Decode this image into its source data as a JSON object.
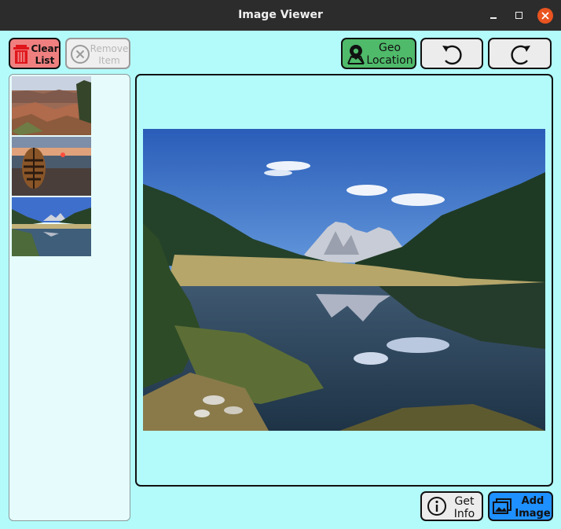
{
  "window": {
    "title": "Image Viewer"
  },
  "toolbar": {
    "clear_list": "Clear List",
    "remove_item": "Remove Item",
    "geo_location": "Geo Location"
  },
  "thumbnails": [
    {
      "name": "canyon"
    },
    {
      "name": "tiger-egg-sunset"
    },
    {
      "name": "mountain-lake"
    }
  ],
  "footer": {
    "get_info": "Get Info",
    "add_image": "Add Image"
  },
  "icons": {
    "clear": "trash-icon",
    "remove": "x-circle-icon",
    "geo": "map-pin-icon",
    "rotate_left": "rotate-ccw-icon",
    "rotate_right": "rotate-cw-icon",
    "info": "info-icon",
    "add": "images-icon"
  },
  "colors": {
    "background": "#b3fbfb",
    "clear_button": "#f08080",
    "geo_button": "#4fba6a",
    "add_button": "#1e90ff",
    "close_button": "#e95420"
  }
}
